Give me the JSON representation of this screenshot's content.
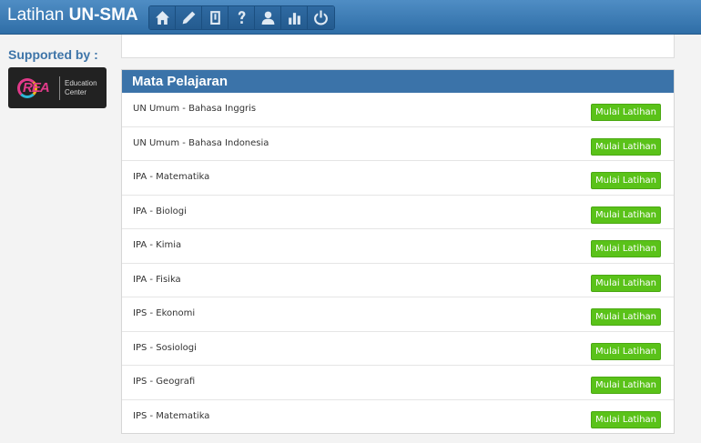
{
  "header": {
    "title_light": "Latihan ",
    "title_bold": "UN-SMA",
    "nav_icons": [
      "home-icon",
      "pencil-icon",
      "book-icon",
      "help-icon",
      "user-icon",
      "stats-icon",
      "power-icon"
    ]
  },
  "sidebar": {
    "supported_label": "Supported by :",
    "logo": {
      "mark_text": "REA",
      "text": "Education\nCenter"
    }
  },
  "main": {
    "panel_title": "Mata Pelajaran",
    "subjects": [
      {
        "label": "UN Umum - Bahasa Inggris",
        "button": "Mulai Latihan"
      },
      {
        "label": "UN Umum - Bahasa Indonesia",
        "button": "Mulai Latihan"
      },
      {
        "label": "IPA - Matematika",
        "button": "Mulai Latihan"
      },
      {
        "label": "IPA - Biologi",
        "button": "Mulai Latihan"
      },
      {
        "label": "IPA - Kimia",
        "button": "Mulai Latihan"
      },
      {
        "label": "IPA - Fisika",
        "button": "Mulai Latihan"
      },
      {
        "label": "IPS - Ekonomi",
        "button": "Mulai Latihan"
      },
      {
        "label": "IPS - Sosiologi",
        "button": "Mulai Latihan"
      },
      {
        "label": "IPS - Geografi",
        "button": "Mulai Latihan"
      },
      {
        "label": "IPS - Matematika",
        "button": "Mulai Latihan"
      }
    ]
  },
  "colors": {
    "header_blue": "#3b73a9",
    "button_green": "#5ac219"
  }
}
